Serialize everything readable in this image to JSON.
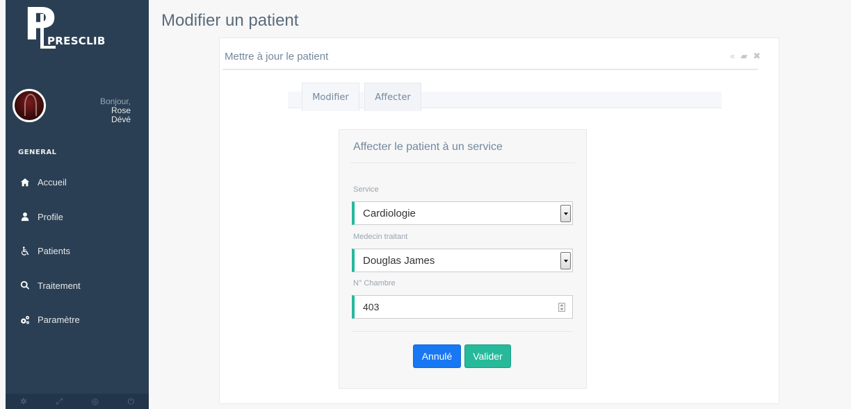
{
  "sidebar": {
    "brand": "PRESCLIB",
    "logo_letter": "P",
    "greeting": "Bonjour,",
    "user_first": "Rose",
    "user_last": "Dévé",
    "section_title": "GENERAL",
    "items": [
      {
        "label": "Accueil",
        "icon": "home-icon"
      },
      {
        "label": "Profile",
        "icon": "user-icon"
      },
      {
        "label": "Patients",
        "icon": "wheelchair-icon"
      },
      {
        "label": "Traitement",
        "icon": "search-icon"
      },
      {
        "label": "Paramètre",
        "icon": "gears-icon"
      }
    ],
    "footer_icons": [
      "settings-icon",
      "fullscreen-icon",
      "eye-slash-icon",
      "power-icon"
    ]
  },
  "page": {
    "title": "Modifier un patient"
  },
  "panel": {
    "title": "Mettre à jour le patient",
    "tools": [
      "collapse-icon",
      "folder-icon",
      "close-icon"
    ]
  },
  "tabs": [
    {
      "label": "Modifier",
      "active": true
    },
    {
      "label": "Affecter",
      "active": false
    }
  ],
  "form": {
    "title": "Affecter le patient à un service",
    "service_label": "Service",
    "service_value": "Cardiologie",
    "medecin_label": "Medecin traitant",
    "medecin_value": "Douglas James",
    "chambre_label": "N° Chambre",
    "chambre_value": "403",
    "cancel_label": "Annulé",
    "submit_label": "Valider"
  },
  "colors": {
    "sidebar_bg": "#2a3f54",
    "accent_green": "#26b99a",
    "button_blue": "#1877f2",
    "text_muted": "#73879c"
  }
}
